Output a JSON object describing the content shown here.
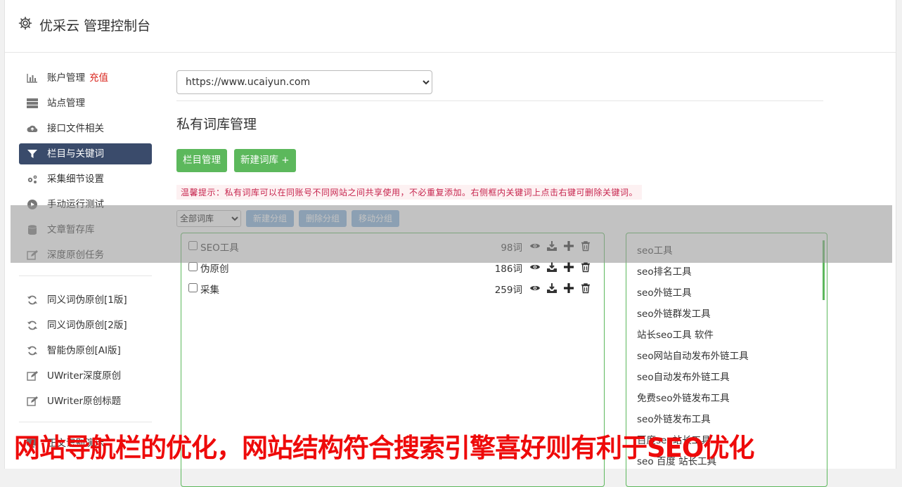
{
  "header": {
    "title": "优采云 管理控制台"
  },
  "sidebar": {
    "group1": [
      {
        "label": "账户管理",
        "extra": "充值",
        "icon": "bar-chart-icon"
      },
      {
        "label": "站点管理",
        "icon": "server-icon"
      },
      {
        "label": "接口文件相关",
        "icon": "cloud-upload-icon"
      },
      {
        "label": "栏目与关键词",
        "icon": "filter-icon",
        "active": true
      },
      {
        "label": "采集细节设置",
        "icon": "cogs-icon"
      },
      {
        "label": "手动运行测试",
        "icon": "play-icon"
      },
      {
        "label": "文章暂存库",
        "icon": "database-icon"
      },
      {
        "label": "深度原创任务",
        "icon": "edit-icon"
      }
    ],
    "group2": [
      {
        "label": "同义词伪原创[1版]",
        "icon": "refresh-icon"
      },
      {
        "label": "同义词伪原创[2版]",
        "icon": "refresh-icon"
      },
      {
        "label": "智能伪原创[AI版]",
        "icon": "refresh-icon"
      },
      {
        "label": "UWriter深度原创",
        "icon": "edit-icon"
      },
      {
        "label": "UWriter原创标题",
        "icon": "edit-icon"
      }
    ],
    "group3": [
      {
        "label": "正文识别演示",
        "icon": "monitor-icon"
      }
    ]
  },
  "main": {
    "site_select": {
      "value": "https://www.ucaiyun.com"
    },
    "heading": "私有词库管理",
    "buttons": {
      "column_manage": "栏目管理",
      "new_library": "新建词库 +"
    },
    "tip": "温馨提示：私有词库可以在同账号不同网站之间共享使用，不必重复添加。右侧框内关键词上点击右键可删除关键词。",
    "toolbar": {
      "filter_value": "全部词库",
      "new_group": "新建分组",
      "delete_group": "删除分组",
      "move_group": "移动分组"
    },
    "libraries": [
      {
        "name": "SEO工具",
        "count": "98词"
      },
      {
        "name": "伪原创",
        "count": "186词"
      },
      {
        "name": "采集",
        "count": "259词"
      }
    ],
    "keywords": [
      "seo工具",
      "seo排名工具",
      "seo外链工具",
      "seo外链群发工具",
      "站长seo工具 软件",
      "seo网站自动发布外链工具",
      "seo自动发布外链工具",
      "免费seo外链发布工具",
      "seo外链发布工具",
      "百度seo站长工具",
      "seo 百度 站长工具"
    ]
  },
  "caption": "网站导航栏的优化，网站结构符合搜索引擎喜好则有利于SEO优化",
  "colors": {
    "accent_green": "#5cb85c",
    "active_nav": "#3a4b6b",
    "caption_red": "#ee0a0a",
    "secondary_blue": "#7eaedb"
  }
}
